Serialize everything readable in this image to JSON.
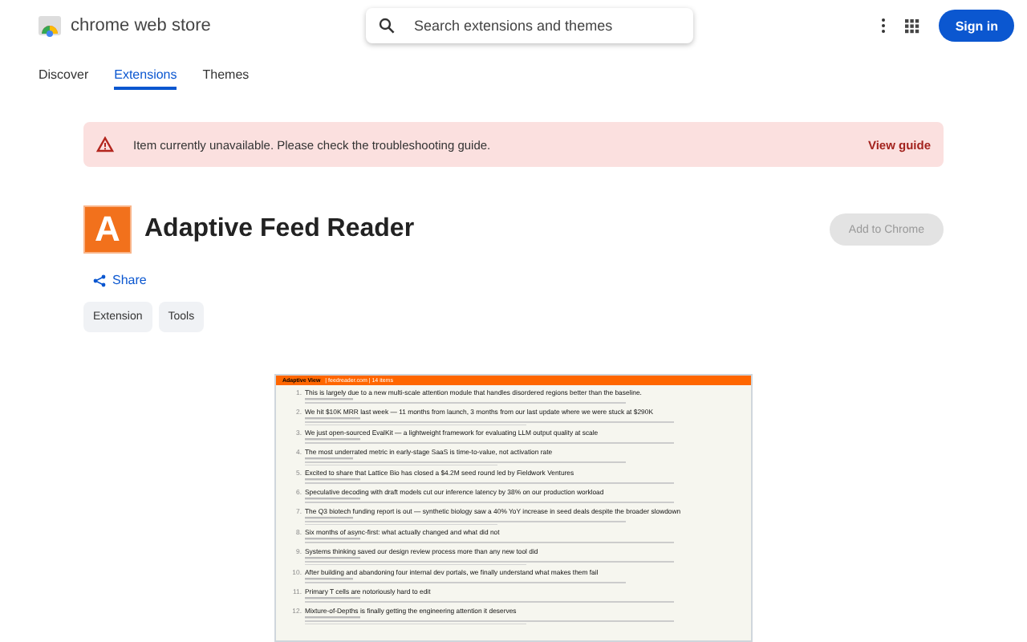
{
  "header": {
    "store_name": "chrome web store",
    "search": {
      "placeholder": "Search extensions and themes"
    },
    "sign_in": "Sign in"
  },
  "nav": [
    {
      "label": "Discover",
      "selected": false
    },
    {
      "label": "Extensions",
      "selected": true
    },
    {
      "label": "Themes",
      "selected": false
    }
  ],
  "banner": {
    "message": "Item currently unavailable. Please check the troubleshooting guide.",
    "link": "View guide"
  },
  "item": {
    "icon_letter": "A",
    "title": "Adaptive Feed Reader",
    "add_button": {
      "label": "Add to Chrome",
      "disabled": true
    },
    "share": "Share",
    "chips": [
      "Extension",
      "Tools"
    ]
  },
  "screenshot": {
    "header_title": "Adaptive View",
    "header_meta": "| feedreader.com | 14 items",
    "posts": [
      {
        "number": "1.",
        "title": "This is largely due to a new multi-scale attention module that handles disordered regions better than the baseline."
      },
      {
        "number": "2.",
        "title": "We hit $10K MRR last week — 11 months from launch, 3 months from our last update where we were stuck at $290K"
      },
      {
        "number": "3.",
        "title": "We just open-sourced EvalKit — a lightweight framework for evaluating LLM output quality at scale"
      },
      {
        "number": "4.",
        "title": "The most underrated metric in early-stage SaaS is time-to-value, not activation rate"
      },
      {
        "number": "5.",
        "title": "Excited to share that Lattice Bio has closed a $4.2M seed round led by Fieldwork Ventures"
      },
      {
        "number": "6.",
        "title": "Speculative decoding with draft models cut our inference latency by 38% on our production workload"
      },
      {
        "number": "7.",
        "title": "The Q3 biotech funding report is out — synthetic biology saw a 40% YoY increase in seed deals despite the broader slowdown"
      },
      {
        "number": "8.",
        "title": "Six months of async-first: what actually changed and what did not"
      },
      {
        "number": "9.",
        "title": "Systems thinking saved our design review process more than any new tool did"
      },
      {
        "number": "10.",
        "title": "After building and abandoning four internal dev portals, we finally understand what makes them fail"
      },
      {
        "number": "11.",
        "title": "Primary T cells are notoriously hard to edit"
      },
      {
        "number": "12.",
        "title": "Mixture-of-Depths is finally getting the engineering attention it deserves"
      }
    ]
  }
}
